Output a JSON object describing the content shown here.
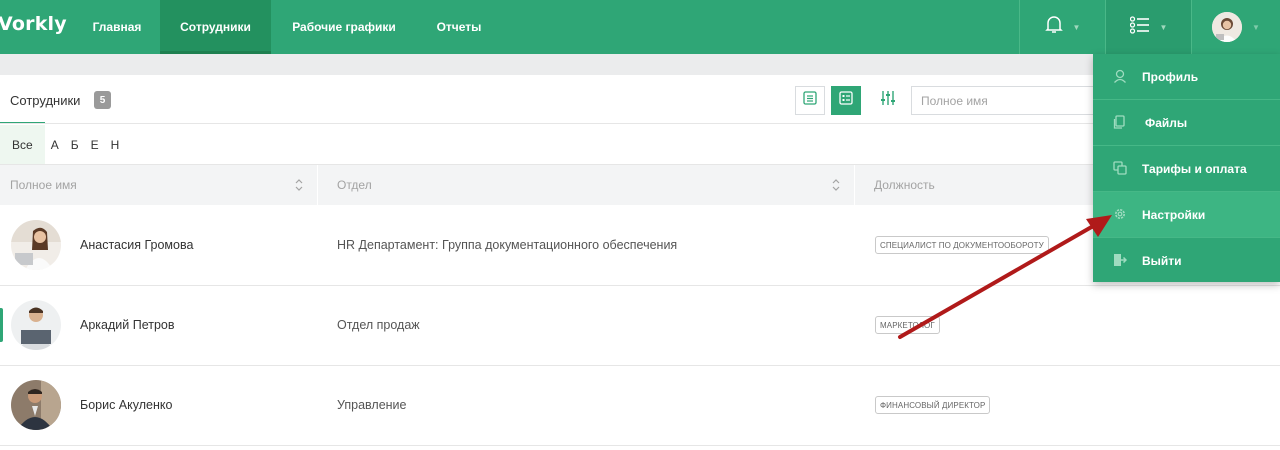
{
  "app": {
    "logo": "Vorkly"
  },
  "nav": [
    {
      "label": "Главная"
    },
    {
      "label": "Сотрудники",
      "active": true
    },
    {
      "label": "Рабочие графики"
    },
    {
      "label": "Отчеты"
    }
  ],
  "panel": {
    "title": "Сотрудники",
    "count": "5"
  },
  "search": {
    "placeholder": "Полное имя"
  },
  "letters": [
    "Все",
    "А",
    "Б",
    "Е",
    "Н"
  ],
  "table": {
    "columns": [
      "Полное имя",
      "Отдел",
      "Должность"
    ],
    "rows": [
      {
        "name": "Анастасия Громова",
        "department": "HR Департамент: Группа документационного обеспечения",
        "position": "СПЕЦИАЛИСТ ПО ДОКУМЕНТООБОРОТУ"
      },
      {
        "name": "Аркадий Петров",
        "department": "Отдел продаж",
        "position": "МАРКЕТОЛОГ"
      },
      {
        "name": "Борис Акуленко",
        "department": "Управление",
        "position": "ФИНАНСОВЫЙ ДИРЕКТОР"
      }
    ]
  },
  "menu": [
    {
      "label": "Профиль",
      "icon": "user-icon"
    },
    {
      "label": "Файлы",
      "icon": "files-icon"
    },
    {
      "label": "Тарифы и оплата",
      "icon": "billing-icon"
    },
    {
      "label": "Настройки",
      "icon": "gear-icon"
    },
    {
      "label": "Выйти",
      "icon": "logout-icon"
    }
  ],
  "colors": {
    "brand": "#2fa676",
    "brand_dark": "#23915f",
    "annotation_arrow": "#b01a1a"
  }
}
